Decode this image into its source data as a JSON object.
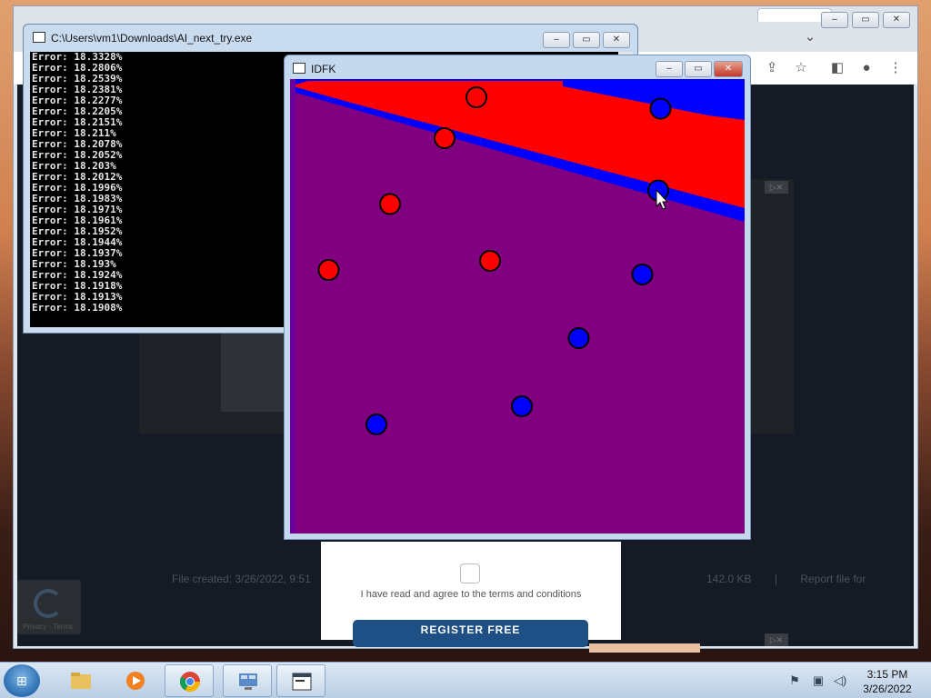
{
  "console": {
    "title": "C:\\Users\\vm1\\Downloads\\AI_next_try.exe",
    "lines": [
      "Error: 18.3328%",
      "Error: 18.2806%",
      "Error: 18.2539%",
      "Error: 18.2381%",
      "Error: 18.2277%",
      "Error: 18.2205%",
      "Error: 18.2151%",
      "Error: 18.211%",
      "Error: 18.2078%",
      "Error: 18.2052%",
      "Error: 18.203%",
      "Error: 18.2012%",
      "Error: 18.1996%",
      "Error: 18.1983%",
      "Error: 18.1971%",
      "Error: 18.1961%",
      "Error: 18.1952%",
      "Error: 18.1944%",
      "Error: 18.1937%",
      "Error: 18.193%",
      "Error: 18.1924%",
      "Error: 18.1918%",
      "Error: 18.1913%",
      "Error: 18.1908%"
    ]
  },
  "idfk": {
    "title": "IDFK",
    "colors": {
      "red": "#ff0000",
      "blue": "#0000ff",
      "purple": "#800080"
    },
    "points": [
      {
        "cls": "red",
        "cx": 0.41,
        "cy": 0.04
      },
      {
        "cls": "red",
        "cx": 0.34,
        "cy": 0.13
      },
      {
        "cls": "red",
        "cx": 0.22,
        "cy": 0.275
      },
      {
        "cls": "red",
        "cx": 0.085,
        "cy": 0.42
      },
      {
        "cls": "red",
        "cx": 0.44,
        "cy": 0.4
      },
      {
        "cls": "blue",
        "cx": 0.815,
        "cy": 0.065
      },
      {
        "cls": "blue",
        "cx": 0.81,
        "cy": 0.245
      },
      {
        "cls": "blue",
        "cx": 0.775,
        "cy": 0.43
      },
      {
        "cls": "blue",
        "cx": 0.635,
        "cy": 0.57
      },
      {
        "cls": "blue",
        "cx": 0.51,
        "cy": 0.72
      },
      {
        "cls": "blue",
        "cx": 0.19,
        "cy": 0.76
      }
    ]
  },
  "browser": {
    "file_created": "File created: 3/26/2022, 9:51",
    "file_size": "142.0 KB",
    "separator": "|",
    "report": "Report file for",
    "terms": "I have read and agree to the terms and conditions",
    "register": "REGISTER FREE",
    "recaptcha_text": "Privacy - Terms"
  },
  "taskbar": {
    "time": "3:15 PM",
    "date": "3/26/2022"
  }
}
